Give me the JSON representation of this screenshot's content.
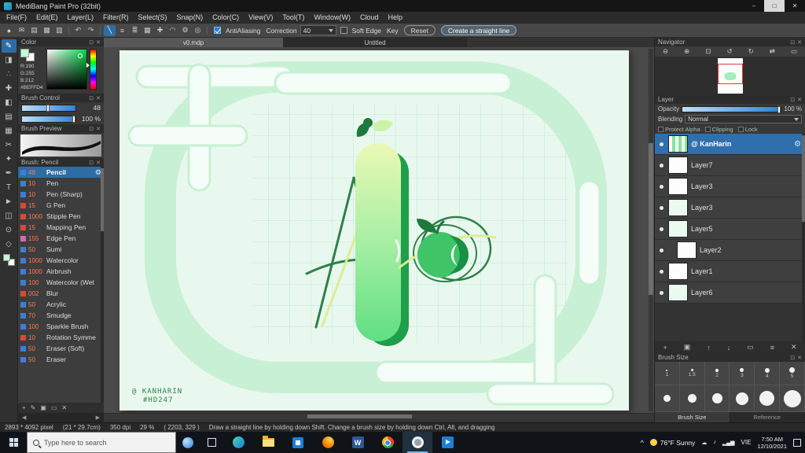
{
  "app": {
    "title": "MediBang Paint Pro (32bit)"
  },
  "window_controls": {
    "minimize": "–",
    "maximize": "□",
    "close": "✕"
  },
  "ui": {
    "panel_pop_icon": "⊡",
    "panel_close_icon": "✕",
    "gear_icon": "⚙",
    "undo_icon": "↶",
    "redo_icon": "↷",
    "left_arrow": "◀",
    "right_arrow": "▶",
    "chevron_up": "^"
  },
  "menubar": {
    "items": [
      "File(F)",
      "Edit(E)",
      "Layer(L)",
      "Filter(R)",
      "Select(S)",
      "Snap(N)",
      "Color(C)",
      "View(V)",
      "Tool(T)",
      "Window(W)",
      "Cloud",
      "Help"
    ]
  },
  "toolbar": {
    "left_icons": [
      {
        "name": "brush-tip-icon",
        "glyph": "●"
      },
      {
        "name": "message-icon",
        "glyph": "✉"
      },
      {
        "name": "panel-icon",
        "glyph": "▤"
      },
      {
        "name": "material-icon",
        "glyph": "▦"
      },
      {
        "name": "stamp-icon",
        "glyph": "▥"
      }
    ],
    "line_icons": [
      {
        "name": "straight-line-icon",
        "glyph": "╲"
      },
      {
        "name": "parallel-lines-icon",
        "glyph": "≡"
      },
      {
        "name": "multi-lines-icon",
        "glyph": "≣"
      },
      {
        "name": "crosshatch-icon",
        "glyph": "▦"
      },
      {
        "name": "cross-icon",
        "glyph": "✚"
      },
      {
        "name": "curve-icon",
        "glyph": "◠"
      },
      {
        "name": "snap-settings-icon",
        "glyph": "⚙"
      },
      {
        "name": "target-icon",
        "glyph": "◎"
      }
    ],
    "antialiasing_label": "AntiAliasing",
    "correction_label": "Correction",
    "correction_value": "40",
    "soft_edge_label": "Soft Edge",
    "key_label": "Key",
    "reset_label": "Reset",
    "create_line_label": "Create a straight line"
  },
  "tool_column": {
    "tools": [
      {
        "name": "brush-tool",
        "glyph": "✎"
      },
      {
        "name": "eraser-tool",
        "glyph": "◨"
      },
      {
        "name": "dot-pen-tool",
        "glyph": "∴"
      },
      {
        "name": "move-tool",
        "glyph": "✚"
      },
      {
        "name": "fill-tool",
        "glyph": "◧"
      },
      {
        "name": "gradient-tool",
        "glyph": "▤"
      },
      {
        "name": "select-tool",
        "glyph": "▦"
      },
      {
        "name": "lasso-tool",
        "glyph": "✂"
      },
      {
        "name": "magic-wand-tool",
        "glyph": "✦"
      },
      {
        "name": "select-pen-tool",
        "glyph": "✒"
      },
      {
        "name": "text-tool",
        "glyph": "T"
      },
      {
        "name": "operation-tool",
        "glyph": "►"
      },
      {
        "name": "divide-tool",
        "glyph": "◫"
      },
      {
        "name": "eyedropper-tool",
        "glyph": "⊙"
      },
      {
        "name": "hand-tool",
        "glyph": "◇"
      }
    ]
  },
  "tabs": {
    "tab1": "v0.mdp",
    "tab2": "Untitled"
  },
  "color_panel": {
    "title": "Color",
    "r": "R:190",
    "g": "G:255",
    "b": "B:212",
    "hex": "#BEFFD4"
  },
  "brush_control": {
    "title": "Brush Control",
    "size_value": "48",
    "opacity_value": "100 %"
  },
  "brush_preview": {
    "title": "Brush Preview"
  },
  "brush_panel": {
    "title": "Brush: Pencil",
    "items": [
      {
        "size": "48",
        "name": "Pencil"
      },
      {
        "size": "10",
        "name": "Pen"
      },
      {
        "size": "10",
        "name": "Pen (Sharp)"
      },
      {
        "size": "15",
        "name": "G Pen"
      },
      {
        "size": "1000",
        "name": "Stipple Pen"
      },
      {
        "size": "15",
        "name": "Mapping Pen"
      },
      {
        "size": "155",
        "name": "Edge Pen"
      },
      {
        "size": "50",
        "name": "Sumi"
      },
      {
        "size": "1000",
        "name": "Watercolor"
      },
      {
        "size": "1000",
        "name": "Airbrush"
      },
      {
        "size": "100",
        "name": "Watercolor (Wet"
      },
      {
        "size": "002",
        "name": "Blur"
      },
      {
        "size": "50",
        "name": "Acrylic"
      },
      {
        "size": "70",
        "name": "Smudge"
      },
      {
        "size": "100",
        "name": "Sparkle Brush"
      },
      {
        "size": "10",
        "name": "Rotation Symme"
      },
      {
        "size": "50",
        "name": "Eraser (Soft)"
      },
      {
        "size": "50",
        "name": "Eraser"
      }
    ],
    "action_icons": [
      {
        "name": "add-brush-icon",
        "glyph": "+"
      },
      {
        "name": "edit-brush-icon",
        "glyph": "✎"
      },
      {
        "name": "duplicate-brush-icon",
        "glyph": "▣"
      },
      {
        "name": "brush-folder-icon",
        "glyph": "▭"
      },
      {
        "name": "delete-brush-icon",
        "glyph": "✕"
      }
    ]
  },
  "navigator": {
    "title": "Navigator",
    "icons": [
      {
        "name": "zoom-out-icon",
        "glyph": "⊖"
      },
      {
        "name": "zoom-in-icon",
        "glyph": "⊕"
      },
      {
        "name": "fit-view-icon",
        "glyph": "⊡"
      },
      {
        "name": "rotate-ccw-icon",
        "glyph": "↺"
      },
      {
        "name": "rotate-cw-icon",
        "glyph": "↻"
      },
      {
        "name": "reset-rotation-icon",
        "glyph": "⇄"
      },
      {
        "name": "flip-view-icon",
        "glyph": "▭"
      }
    ]
  },
  "layer_panel": {
    "title": "Layer",
    "opacity_label": "Opacity",
    "opacity_value": "100 %",
    "blending_label": "Blending",
    "blending_value": "Normal",
    "protect_alpha_label": "Protect Alpha",
    "clipping_label": "Clipping",
    "lock_label": "Lock",
    "layers": [
      {
        "name": "@ KanHarin"
      },
      {
        "name": "Layer7"
      },
      {
        "name": "Layer3"
      },
      {
        "name": "Layer3"
      },
      {
        "name": "Layer5"
      },
      {
        "name": "Layer2"
      },
      {
        "name": "Layer1"
      },
      {
        "name": "Layer6"
      }
    ],
    "action_icons": [
      {
        "name": "add-layer-icon",
        "glyph": "+"
      },
      {
        "name": "duplicate-layer-icon",
        "glyph": "▣"
      },
      {
        "name": "layer-up-icon",
        "glyph": "↑"
      },
      {
        "name": "layer-down-icon",
        "glyph": "↓"
      },
      {
        "name": "add-folder-icon",
        "glyph": "▭"
      },
      {
        "name": "merge-layer-icon",
        "glyph": "≡"
      },
      {
        "name": "delete-layer-icon",
        "glyph": "✕"
      }
    ]
  },
  "brush_size_panel": {
    "title": "Brush Size",
    "reference_tab": "Reference",
    "row1_labels": [
      "1",
      "1.5",
      "2",
      "3",
      "4",
      "5"
    ]
  },
  "canvas": {
    "signature_line1": "@ KANHARIN",
    "signature_line2": "#HD247"
  },
  "statusbar": {
    "size": "2893 * 4092 pixel",
    "dims": "(21 * 29.7cm)",
    "dpi": "350 dpi",
    "zoom": "29 %",
    "coords": "( 2203, 329 )",
    "tip": "Draw a straight line by holding down Shift. Change a brush size by holding down Ctrl, Alt, and dragging"
  },
  "taskbar": {
    "search_placeholder": "Type here to search",
    "weather": "76°F Sunny",
    "language": "VIE",
    "time": "7:50 AM",
    "date": "12/10/2021",
    "word_letter": "W",
    "tray_icons": [
      {
        "name": "onedrive-icon",
        "glyph": "☁"
      },
      {
        "name": "volume-icon",
        "glyph": "♪"
      },
      {
        "name": "network-icon",
        "glyph": "▂▄▆"
      }
    ]
  },
  "colors": {
    "accent_blue": "#2e6da4",
    "slider_blue": "#2f7fd6",
    "brush_chip_blue": "#3b7fd4",
    "brush_chip_red": "#d44a3a",
    "canvas_bg": "#e9f8ee",
    "artwork_green": "#3fc468",
    "selected_hex": "#BEFFD4"
  }
}
